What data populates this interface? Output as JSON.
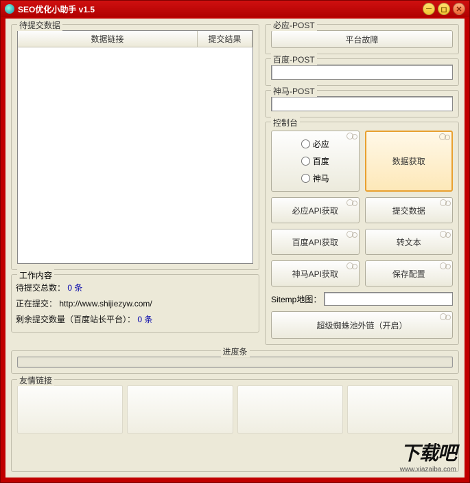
{
  "window": {
    "title": "SEO优化小助手 v1.5"
  },
  "left": {
    "pending_label": "待提交数据",
    "table": {
      "col1": "数据链接",
      "col2": "提交结果"
    },
    "work": {
      "label": "工作内容",
      "total_label": "待提交总数：",
      "total_value": "0 条",
      "submitting_label": "正在提交：",
      "submitting_value": "http://www.shijiezyw.com/",
      "remain_label": "剩余提交数量（百度站长平台）：",
      "remain_value": "0 条"
    }
  },
  "right": {
    "sections": {
      "biying_post": {
        "label": "必应-POST",
        "button": "平台故障"
      },
      "baidu_post": {
        "label": "百度-POST"
      },
      "shenma_post": {
        "label": "神马-POST"
      }
    },
    "console": {
      "label": "控制台",
      "radios": {
        "biying": "必应",
        "baidu": "百度",
        "shenma": "神马"
      },
      "buttons": {
        "fetch": "数据获取",
        "api_biying": "必应API获取",
        "submit": "提交数据",
        "api_baidu": "百度API获取",
        "to_text": "转文本",
        "api_shenma": "神马API获取",
        "save_cfg": "保存配置",
        "spider": "超级蜘蛛池外链（开启）"
      },
      "sitemap_label": "Sitemp地图："
    }
  },
  "progress": {
    "label": "进度条"
  },
  "links": {
    "label": "友情链接"
  },
  "watermark": {
    "big": "下载吧",
    "small": "www.xiazaiba.com"
  }
}
